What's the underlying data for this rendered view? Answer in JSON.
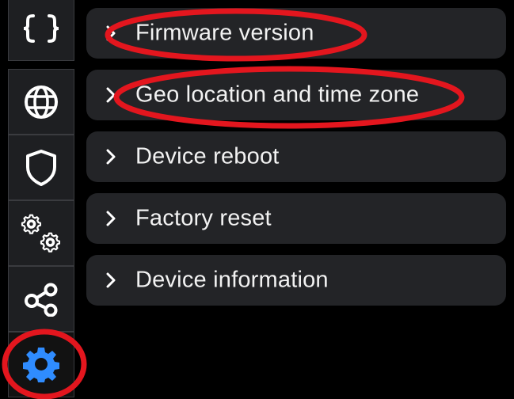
{
  "colors": {
    "background": "#000000",
    "card": "#232427",
    "sidebar_button": "#1e1f22",
    "text": "#f2f2f2",
    "accent_active": "#2f8cff",
    "annotation": "#e3161e"
  },
  "sidebar": {
    "items": [
      {
        "icon": "code-braces-icon",
        "active": false
      },
      {
        "icon": "globe-icon",
        "active": false
      },
      {
        "icon": "shield-icon",
        "active": false
      },
      {
        "icon": "gears-icon",
        "active": false
      },
      {
        "icon": "share-nodes-icon",
        "active": false
      },
      {
        "icon": "gear-icon",
        "active": true
      }
    ]
  },
  "accordion": {
    "items": [
      {
        "label": "Firmware version",
        "icon": "chevron-right-icon"
      },
      {
        "label": "Geo location and time zone",
        "icon": "chevron-right-icon"
      },
      {
        "label": "Device reboot",
        "icon": "chevron-right-icon"
      },
      {
        "label": "Factory reset",
        "icon": "chevron-right-icon"
      },
      {
        "label": "Device information",
        "icon": "chevron-right-icon"
      }
    ]
  }
}
